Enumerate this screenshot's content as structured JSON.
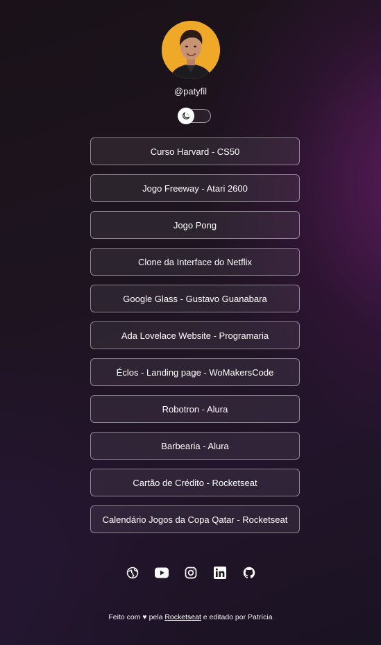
{
  "profile": {
    "handle": "@patyfil"
  },
  "theme_toggle": {
    "icon": "moon-icon"
  },
  "links": [
    {
      "label": "Curso Harvard - CS50"
    },
    {
      "label": "Jogo Freeway - Atari 2600"
    },
    {
      "label": "Jogo Pong"
    },
    {
      "label": "Clone da Interface do Netflix"
    },
    {
      "label": "Google Glass - Gustavo Guanabara"
    },
    {
      "label": "Ada Lovelace Website - Programaria"
    },
    {
      "label": "Éclos - Landing page - WoMakersCode"
    },
    {
      "label": "Robotron - Alura"
    },
    {
      "label": "Barbearia - Alura"
    },
    {
      "label": "Cartão de Crédito - Rocketseat"
    },
    {
      "label": "Calendário Jogos da Copa Qatar - Rocketseat"
    }
  ],
  "social": [
    {
      "icon": "globe-icon"
    },
    {
      "icon": "youtube-icon"
    },
    {
      "icon": "instagram-icon"
    },
    {
      "icon": "linkedin-icon"
    },
    {
      "icon": "github-icon"
    }
  ],
  "footer": {
    "prefix": "Feito com",
    "heart": "♥",
    "by": "pela",
    "link": "Rocketseat",
    "suffix": "e editado por Patrícia"
  },
  "colors": {
    "avatar_bg": "#f0a829",
    "text": "#ffffff"
  }
}
